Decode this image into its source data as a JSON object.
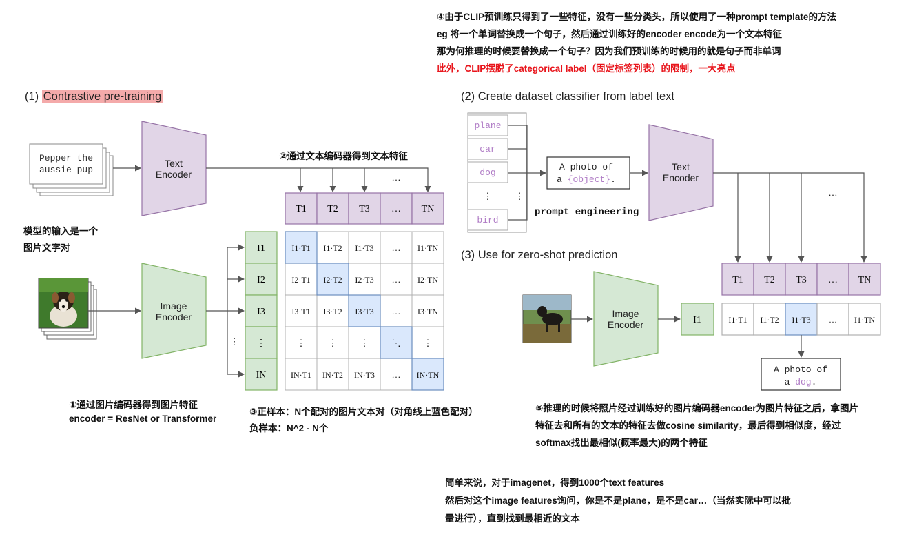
{
  "colors": {
    "text_encoder_fill": "#e1d5e7",
    "text_encoder_stroke": "#9673a6",
    "image_encoder_fill": "#d5e8d4",
    "image_encoder_stroke": "#82b366",
    "diag_cell_fill": "#dae8fc",
    "diag_cell_stroke": "#6c8ebf",
    "highlight_red": "#e8141b",
    "heading_highlight": "#f4aaaa"
  },
  "notes": {
    "top_line1": "④由于CLIP预训练只得到了一些特征，没有一些分类头，所以使用了一种prompt template的方法",
    "top_line2": "eg 将一个单词替换成一个句子，然后通过训练好的encoder encode为一个文本特征",
    "top_line3": "那为何推理的时候要替换成一个句子？因为我们预训练的时候用的就是句子而非单词",
    "top_line4_red": "此外，CLIP摆脱了categorical label（固定标签列表）的限制，一大亮点",
    "model_input_line1": "模型的输入是一个",
    "model_input_line2": "图片文字对",
    "text_feature_note": "②通过文本编码器得到文本特征",
    "image_feature_line1": "①通过图片编码器得到图片特征",
    "image_feature_line2": "encoder = ResNet or Transformer",
    "pos_samples": "③正样本：N个配对的图片文本对（对角线上蓝色配对）",
    "neg_samples": "负样本：N^2 - N个",
    "inference_line1": "⑤推理的时候将照片经过训练好的图片编码器encoder为图片特征之后，拿图片",
    "inference_line2": "特征去和所有的文本的特征去做cosine similarity，最后得到相似度，经过",
    "inference_line3": "softmax找出最相似(概率最大)的两个特征",
    "summary_line1": "简单来说，对于imagenet，得到1000个text features",
    "summary_line2": "然后对这个image features询问，你是不是plane，是不是car…（当然实际中可以批",
    "summary_line3": "量进行），直到找到最相近的文本"
  },
  "section1": {
    "prefix": "(1) ",
    "title": "Contrastive pre-training",
    "caption_line1": "Pepper the",
    "caption_line2": "aussie pup",
    "text_encoder_line1": "Text",
    "text_encoder_line2": "Encoder",
    "image_encoder_line1": "Image",
    "image_encoder_line2": "Encoder",
    "text_features": [
      "T1",
      "T2",
      "T3",
      "…",
      "TN"
    ],
    "image_features": [
      "I1",
      "I2",
      "I3",
      "⋮",
      "IN"
    ],
    "matrix": [
      [
        "I1·T1",
        "I1·T2",
        "I1·T3",
        "…",
        "I1·TN"
      ],
      [
        "I2·T1",
        "I2·T2",
        "I2·T3",
        "…",
        "I2·TN"
      ],
      [
        "I3·T1",
        "I3·T2",
        "I3·T3",
        "…",
        "I3·TN"
      ],
      [
        "⋮",
        "⋮",
        "⋮",
        "⋱",
        "⋮"
      ],
      [
        "IN·T1",
        "IN·T2",
        "IN·T3",
        "…",
        "IN·TN"
      ]
    ],
    "ellipsis": "…",
    "vdots": "⋮"
  },
  "section2": {
    "title": "(2) Create dataset classifier from label text",
    "labels": [
      "plane",
      "car",
      "dog",
      "⋮",
      "bird"
    ],
    "vdots": "⋮",
    "template_line1": "A photo of",
    "template_line2_prefix": "a ",
    "template_object": "{object}",
    "template_line2_suffix": ".",
    "prompt_engineering": "prompt engineering",
    "text_encoder_line1": "Text",
    "text_encoder_line2": "Encoder",
    "ellipsis": "…"
  },
  "section3": {
    "title": "(3) Use for zero-shot prediction",
    "image_encoder_line1": "Image",
    "image_encoder_line2": "Encoder",
    "image_feature": "I1",
    "text_features": [
      "T1",
      "T2",
      "T3",
      "…",
      "TN"
    ],
    "scores": [
      "I1·T1",
      "I1·T2",
      "I1·T3",
      "…",
      "I1·TN"
    ],
    "result_line1": "A photo of",
    "result_line2_prefix": "a ",
    "result_word": "dog",
    "result_line2_suffix": "."
  }
}
